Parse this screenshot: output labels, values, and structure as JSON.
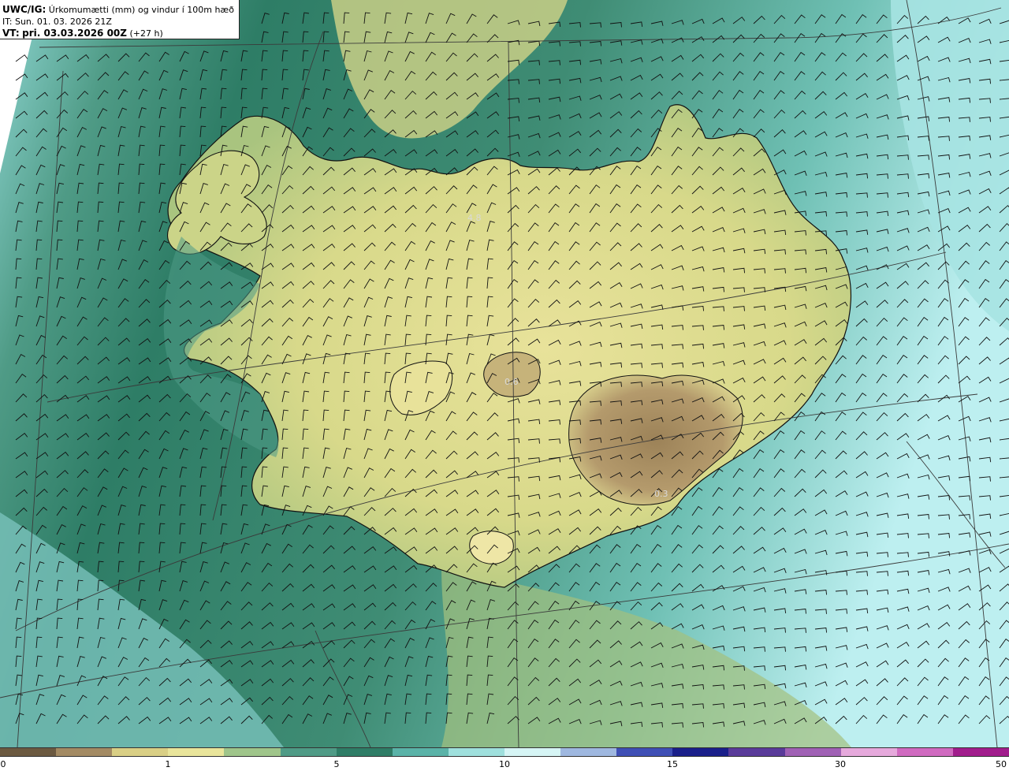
{
  "header": {
    "model": "UWC/IG:",
    "title": "Úrkomumætti (mm) og vindur í 100m hæð",
    "it_line": "IT: Sun. 01. 03. 2026 21Z",
    "vt_prefix": "VT:",
    "vt_value": "pri. 03.03.2026 00Z",
    "vt_lead": "(+27 h)"
  },
  "map": {
    "value_labels": [
      "4.8",
      "0.6",
      "0.3"
    ],
    "colors": {
      "ocean_deep": "#2e7d66",
      "ocean_mid": "#4f9b86",
      "ocean_light": "#8fd6d2",
      "ocean_pale": "#bdeff0",
      "land_yellow": "#d8d98a",
      "land_pale": "#e8e29a",
      "land_green": "#9fbf7a",
      "glacier_brown": "#a38a63",
      "coast": "#111111",
      "grid_line": "#3a3a3a",
      "barb": "#111111"
    }
  },
  "colorbar": {
    "ticks": [
      "0",
      "1",
      "5",
      "10",
      "15",
      "30",
      "50"
    ],
    "colors": [
      "#6b5940",
      "#a38a63",
      "#d9cf85",
      "#e9e59b",
      "#9fc58a",
      "#4f9b86",
      "#2e7d66",
      "#5ab3a8",
      "#9fe0dd",
      "#d6f5f5",
      "#9fb8e0",
      "#3f4fb5",
      "#1a1f8a",
      "#5a3b9a",
      "#a061b5",
      "#e6a9dc",
      "#d06ac0",
      "#a11d8c"
    ]
  }
}
